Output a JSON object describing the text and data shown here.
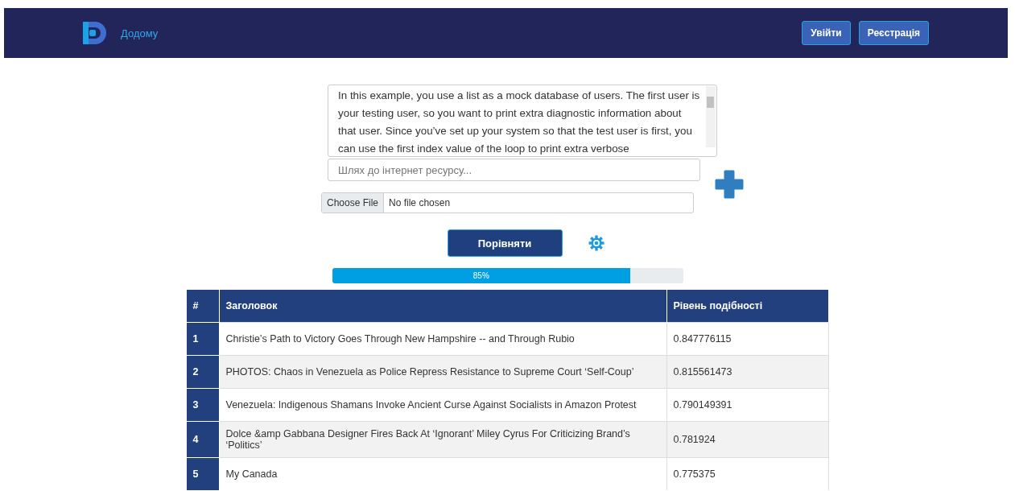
{
  "navbar": {
    "home_link": "Додому",
    "buttons": [
      "Увійти",
      "Реєстрація"
    ]
  },
  "form": {
    "text_value": "In this example, you use a list as a mock database of users. The first user is your testing user, so you want to print extra diagnostic information about that user. Since you’ve set up your system so that the test user is first, you can use the first index value of the loop to print extra verbose",
    "url_placeholder": "Шлях до інтернет ресурсу...",
    "file_button": "Choose File",
    "file_status": "No file chosen",
    "submit": "Порівняти"
  },
  "progress": {
    "level": 0.85,
    "reading": "85%"
  },
  "table": {
    "columns": [
      "#",
      "Заголовок",
      "Рівень подібності"
    ],
    "rows": [
      {
        "index": "1",
        "title": "Christie’s Path to Victory Goes Through New Hampshire -- and Through Rubio",
        "score": "0.847776115"
      },
      {
        "index": "2",
        "title": "PHOTOS: Chaos in Venezuela as Police Repress Resistance to Supreme Court ‘Self-Coup’",
        "score": "0.815561473"
      },
      {
        "index": "3",
        "title": "Venezuela: Indigenous Shamans Invoke Ancient Curse Against Socialists in Amazon Protest",
        "score": "0.790149391"
      },
      {
        "index": "4",
        "title": "Dolce &amp Gabbana Designer Fires Back At ‘Ignorant’ Miley Cyrus For Criticizing Brand’s ‘Politics’",
        "score": "0.781924"
      },
      {
        "index": "5",
        "title": "My Canada",
        "score": "0.775375"
      }
    ]
  }
}
